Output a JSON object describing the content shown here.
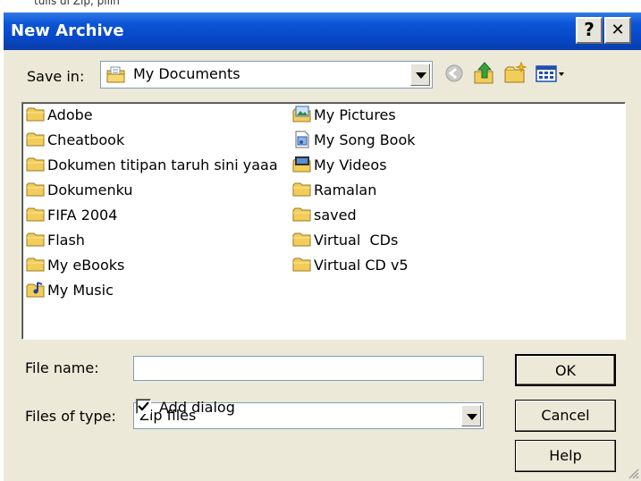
{
  "page": {
    "strip_text": "tulis di Zip, pilih"
  },
  "titlebar": {
    "title": "New Archive",
    "help": "?",
    "close": "✕"
  },
  "toolbar": {
    "save_in_label": "Save in:",
    "location": "My Documents"
  },
  "files": {
    "column1": [
      "Adobe",
      "Cheatbook",
      "Dokumen titipan taruh sini yaaa",
      "Dokumenku",
      "FIFA 2004",
      "Flash",
      "My eBooks",
      "My Music"
    ],
    "column2": [
      "My Pictures",
      "My Song Book",
      "My Videos",
      "Ramalan",
      "saved",
      "Virtual  CDs",
      "Virtual CD v5"
    ]
  },
  "form": {
    "filename_label": "File name:",
    "filename_value": "",
    "filetype_label": "Files of type:",
    "filetype_value": "Zip files",
    "add_dialog_label": "Add dialog",
    "add_dialog_checked": true
  },
  "buttons": {
    "ok": "OK",
    "cancel": "Cancel",
    "help": "Help"
  },
  "colors": {
    "titlebar": "#0647c6",
    "dialog_bg": "#ece9d8",
    "folder": "#f2cd5a"
  }
}
